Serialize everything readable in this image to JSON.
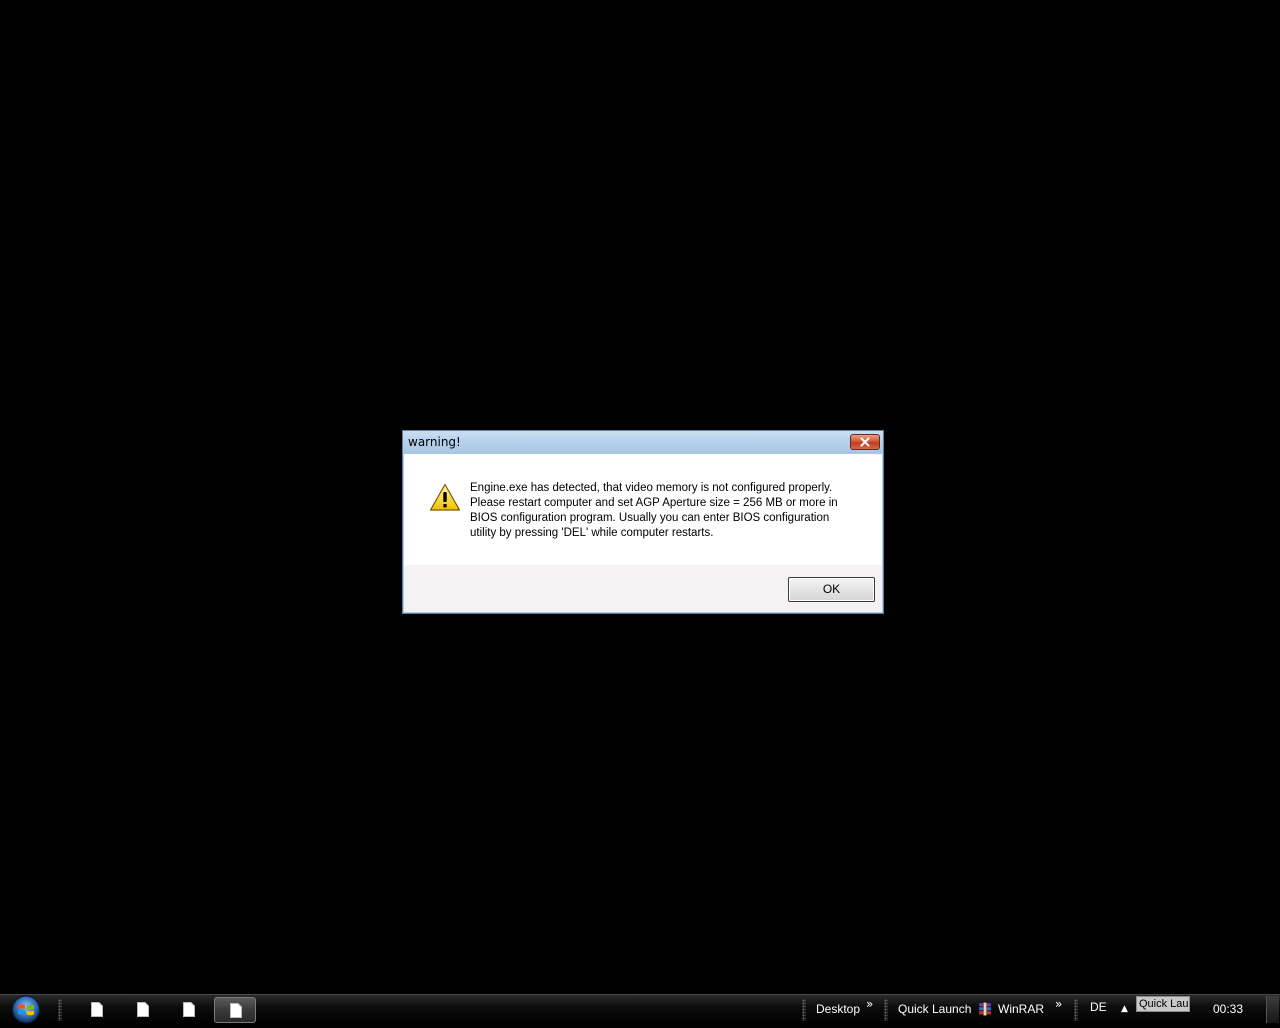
{
  "dialog": {
    "title": "warning!",
    "message_lines": [
      "Engine.exe has detected, that video memory is not configured properly.",
      "Please restart computer and set AGP Aperture size = 256 MB or more in",
      "BIOS configuration program. Usually you can enter BIOS configuration",
      "utility by pressing 'DEL' while computer restarts."
    ],
    "ok_label": "OK",
    "icon": "warning-icon"
  },
  "taskbar": {
    "start_icon": "windows-logo-icon",
    "task_buttons": [
      {
        "icon": "document-icon",
        "active": false
      },
      {
        "icon": "document-icon",
        "active": false
      },
      {
        "icon": "document-icon",
        "active": false
      },
      {
        "icon": "document-icon",
        "active": true
      }
    ],
    "toolbars": {
      "desktop_label": "Desktop",
      "quick_launch_label": "Quick Launch",
      "winrar_label": "WinRAR",
      "chevron": "»"
    },
    "tray": {
      "language": "DE",
      "tooltip": "Quick Lau",
      "clock": "00:33"
    }
  },
  "colors": {
    "desktop_background": "#000000",
    "dialog_frame": "#aecde8",
    "close_button": "#c9452a"
  }
}
